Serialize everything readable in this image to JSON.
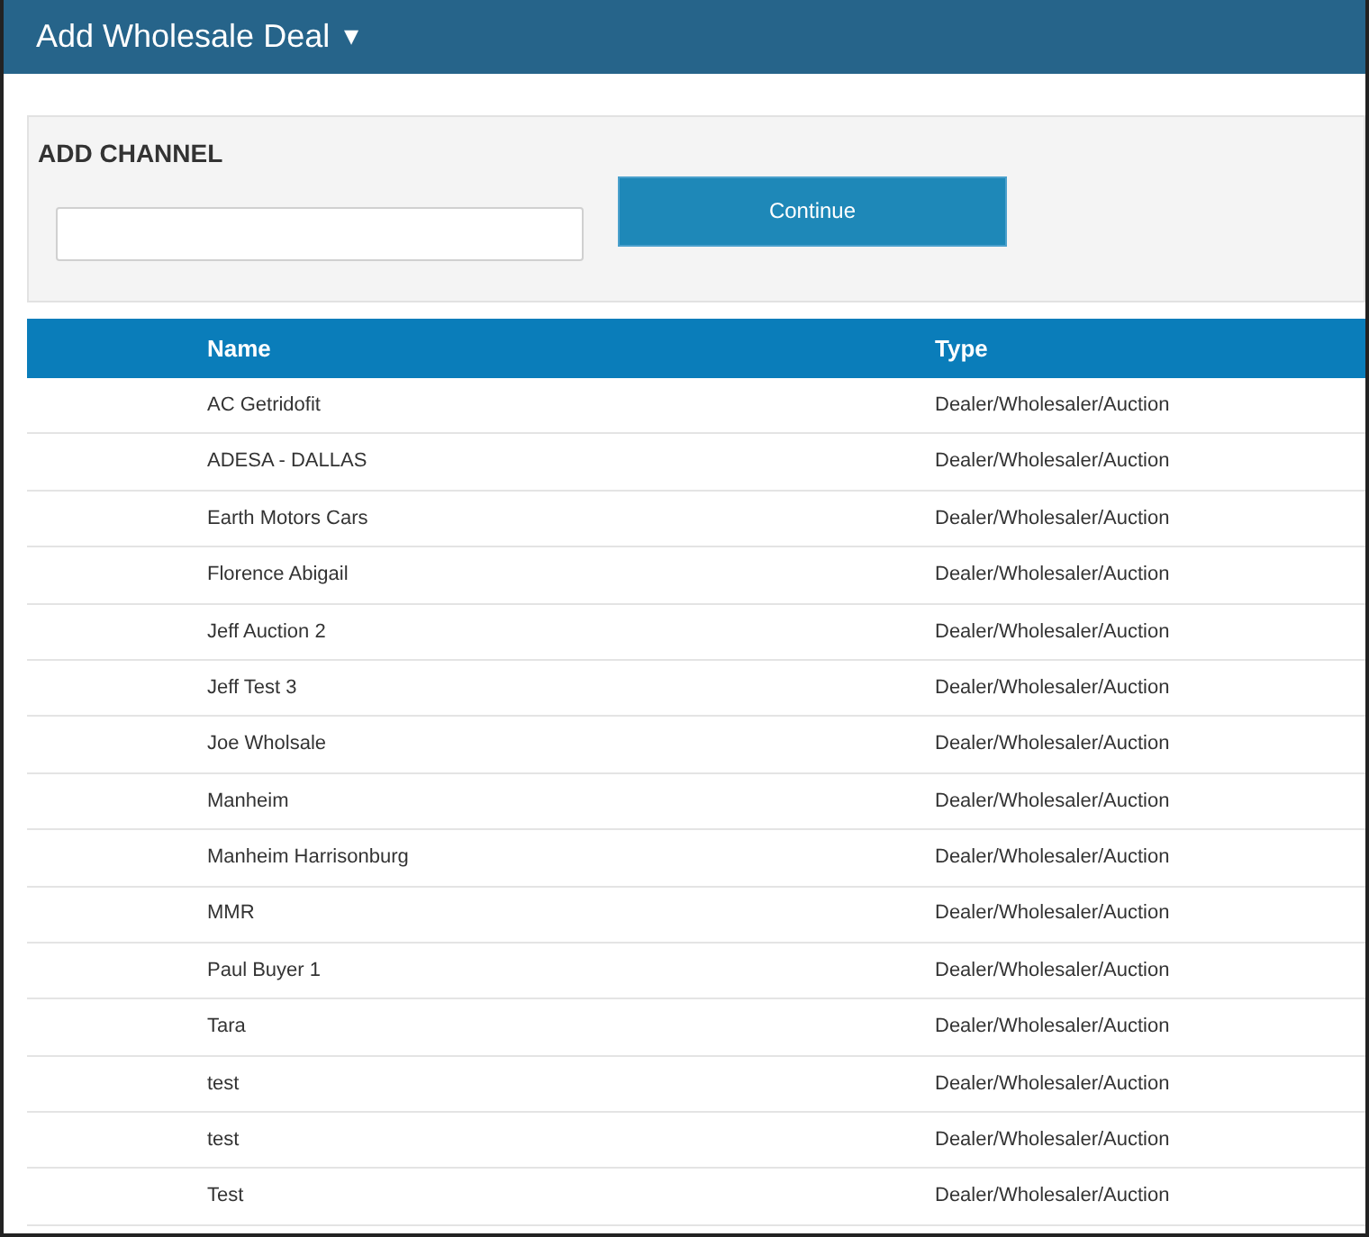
{
  "header": {
    "title": "Add Wholesale Deal",
    "menu_caret": "▾"
  },
  "panel": {
    "title": "ADD CHANNEL",
    "button": "Continue"
  },
  "table": {
    "columns": [
      "Name",
      "Type"
    ],
    "rows": [
      [
        "AC Getridofit",
        "Dealer/Wholesaler/Auction"
      ],
      [
        "ADESA - DALLAS",
        "Dealer/Wholesaler/Auction"
      ],
      [
        "Earth Motors Cars",
        "Dealer/Wholesaler/Auction"
      ],
      [
        "Florence Abigail",
        "Dealer/Wholesaler/Auction"
      ],
      [
        "Jeff Auction 2",
        "Dealer/Wholesaler/Auction"
      ],
      [
        "Jeff Test 3",
        "Dealer/Wholesaler/Auction"
      ],
      [
        "Joe Wholsale",
        "Dealer/Wholesaler/Auction"
      ],
      [
        "Manheim",
        "Dealer/Wholesaler/Auction"
      ],
      [
        "Manheim Harrisonburg",
        "Dealer/Wholesaler/Auction"
      ],
      [
        "MMR",
        "Dealer/Wholesaler/Auction"
      ],
      [
        "Paul Buyer 1",
        "Dealer/Wholesaler/Auction"
      ],
      [
        "Tara",
        "Dealer/Wholesaler/Auction"
      ],
      [
        "test",
        "Dealer/Wholesaler/Auction"
      ],
      [
        "test",
        "Dealer/Wholesaler/Auction"
      ],
      [
        "Test",
        "Dealer/Wholesaler/Auction"
      ]
    ]
  }
}
